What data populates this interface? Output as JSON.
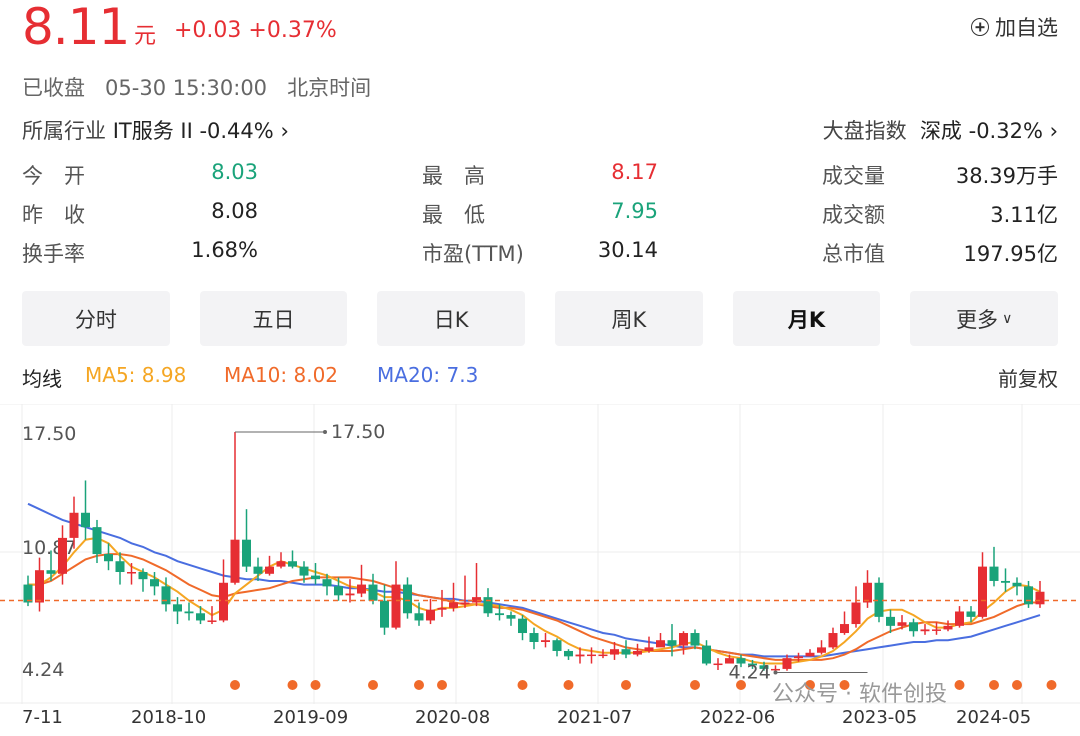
{
  "header": {
    "price": "8.11",
    "unit": "元",
    "change": "+0.03 +0.37%",
    "add_watchlist": "加自选",
    "status": "已收盘",
    "datetime": "05-30 15:30:00",
    "timezone": "北京时间",
    "industry": "所属行业",
    "industry_value": "IT服务 II -0.44%",
    "index_label": "大盘指数",
    "index_value": "深成 -0.32%"
  },
  "stats": [
    {
      "label": "今　开",
      "value": "8.03",
      "color": "green"
    },
    {
      "label": "最　高",
      "value": "8.17",
      "color": "red"
    },
    {
      "label": "成交量",
      "value": "38.39万手",
      "color": "black"
    },
    {
      "label": "昨　收",
      "value": "8.08",
      "color": "black"
    },
    {
      "label": "最　低",
      "value": "7.95",
      "color": "green"
    },
    {
      "label": "成交额",
      "value": "3.11亿",
      "color": "black"
    },
    {
      "label": "换手率",
      "value": "1.68%",
      "color": "black"
    },
    {
      "label": "市盈(TTM)",
      "value": "30.14",
      "color": "black"
    },
    {
      "label": "总市值",
      "value": "197.95亿",
      "color": "black"
    }
  ],
  "tabs": [
    "分时",
    "五日",
    "日K",
    "周K",
    "月K",
    "更多"
  ],
  "active_tab": "月K",
  "ma": {
    "title": "均线",
    "ma5": "MA5: 8.98",
    "ma10": "MA10: 8.02",
    "ma20": "MA20: 7.3",
    "adjust": "前复权"
  },
  "colors": {
    "up": "#e62e33",
    "down": "#1aa37a",
    "ma5": "#f5a623",
    "ma10": "#f06a2a",
    "ma20": "#4a6ee0"
  },
  "watermark": "公众号 · 软件创投",
  "chart_data": {
    "type": "candlestick",
    "y_labels": [
      "17.50",
      "10.87",
      "4.24"
    ],
    "ylim": [
      4.24,
      17.5
    ],
    "max_label": "17.50",
    "min_label": "4.24",
    "x_labels": [
      "7-11",
      "2018-10",
      "2019-09",
      "2020-08",
      "2021-07",
      "2022-06",
      "2023-05",
      "2024-05"
    ],
    "last_close": 8.11,
    "candles": [
      [
        9.0,
        8.0,
        9.5,
        7.8
      ],
      [
        8.0,
        9.8,
        10.5,
        7.5
      ],
      [
        9.8,
        9.6,
        10.9,
        9.2
      ],
      [
        9.6,
        11.6,
        12.3,
        9.0
      ],
      [
        11.6,
        13.0,
        13.9,
        11.0
      ],
      [
        13.0,
        12.2,
        14.8,
        11.5
      ],
      [
        12.2,
        10.7,
        12.6,
        10.2
      ],
      [
        10.7,
        10.3,
        11.3,
        9.8
      ],
      [
        10.3,
        9.7,
        10.8,
        9.0
      ],
      [
        9.7,
        9.7,
        10.2,
        9.0
      ],
      [
        9.7,
        9.3,
        9.9,
        8.6
      ],
      [
        9.3,
        8.9,
        9.7,
        8.4
      ],
      [
        8.9,
        7.9,
        9.4,
        7.5
      ],
      [
        7.9,
        7.5,
        8.3,
        6.8
      ],
      [
        7.5,
        7.4,
        8.0,
        7.0
      ],
      [
        7.4,
        7.0,
        7.8,
        6.8
      ],
      [
        7.0,
        7.0,
        7.8,
        6.8
      ],
      [
        7.0,
        9.1,
        10.4,
        6.9
      ],
      [
        9.1,
        11.5,
        17.5,
        9.0
      ],
      [
        11.5,
        10.0,
        13.2,
        9.7
      ],
      [
        10.0,
        9.6,
        10.5,
        9.2
      ],
      [
        9.6,
        10.0,
        10.6,
        9.5
      ],
      [
        10.0,
        10.3,
        10.8,
        9.9
      ],
      [
        10.3,
        10.0,
        10.9,
        9.9
      ],
      [
        10.0,
        9.5,
        10.3,
        9.1
      ],
      [
        9.5,
        9.3,
        10.2,
        9.0
      ],
      [
        9.3,
        8.9,
        9.6,
        8.4
      ],
      [
        8.9,
        8.4,
        9.4,
        8.1
      ],
      [
        8.4,
        8.5,
        9.3,
        8.0
      ],
      [
        8.5,
        9.0,
        10.1,
        8.3
      ],
      [
        9.0,
        8.1,
        9.6,
        7.9
      ],
      [
        8.1,
        6.6,
        9.0,
        6.2
      ],
      [
        6.6,
        9.0,
        10.3,
        6.5
      ],
      [
        9.0,
        7.4,
        9.4,
        7.1
      ],
      [
        7.4,
        7.0,
        8.0,
        6.7
      ],
      [
        7.0,
        7.6,
        8.2,
        6.8
      ],
      [
        7.6,
        7.7,
        8.7,
        7.2
      ],
      [
        7.7,
        8.0,
        9.1,
        7.5
      ],
      [
        8.0,
        8.0,
        9.5,
        7.7
      ],
      [
        8.0,
        8.3,
        10.2,
        7.8
      ],
      [
        8.3,
        7.4,
        8.8,
        7.2
      ],
      [
        7.4,
        7.3,
        7.9,
        7.0
      ],
      [
        7.3,
        7.1,
        7.5,
        6.7
      ],
      [
        7.1,
        6.3,
        7.3,
        5.9
      ],
      [
        6.3,
        5.8,
        6.6,
        5.4
      ],
      [
        5.8,
        5.9,
        6.3,
        5.5
      ],
      [
        5.9,
        5.3,
        6.0,
        5.0
      ],
      [
        5.3,
        5.0,
        5.4,
        4.8
      ],
      [
        5.0,
        5.1,
        5.5,
        4.6
      ],
      [
        5.1,
        5.1,
        5.5,
        4.6
      ],
      [
        5.1,
        5.1,
        5.4,
        4.9
      ],
      [
        5.1,
        5.4,
        5.8,
        4.8
      ],
      [
        5.4,
        5.1,
        5.9,
        4.9
      ],
      [
        5.1,
        5.3,
        5.7,
        5.0
      ],
      [
        5.3,
        5.5,
        6.1,
        5.2
      ],
      [
        5.5,
        5.9,
        6.3,
        5.6
      ],
      [
        5.9,
        5.6,
        6.8,
        5.0
      ],
      [
        5.6,
        6.3,
        6.4,
        5.1
      ],
      [
        6.3,
        5.6,
        6.5,
        5.4
      ],
      [
        5.6,
        4.6,
        5.9,
        4.5
      ],
      [
        4.6,
        4.6,
        4.9,
        4.24
      ],
      [
        4.6,
        4.9,
        5.1,
        4.8
      ],
      [
        4.9,
        4.6,
        5.1,
        4.4
      ],
      [
        4.6,
        4.5,
        4.8,
        4.3
      ],
      [
        4.5,
        4.3,
        4.7,
        4.2
      ],
      [
        4.3,
        4.3,
        4.5,
        4.1
      ],
      [
        4.3,
        4.9,
        5.1,
        4.2
      ],
      [
        4.9,
        5.0,
        5.2,
        4.7
      ],
      [
        5.0,
        5.2,
        5.4,
        5.0
      ],
      [
        5.2,
        5.5,
        5.9,
        5.1
      ],
      [
        5.5,
        6.3,
        6.6,
        5.4
      ],
      [
        6.3,
        6.8,
        7.5,
        6.2
      ],
      [
        6.8,
        8.0,
        8.9,
        6.6
      ],
      [
        8.0,
        9.1,
        9.8,
        7.7
      ],
      [
        9.1,
        7.2,
        9.4,
        6.9
      ],
      [
        7.2,
        6.7,
        7.6,
        6.3
      ],
      [
        6.7,
        6.9,
        7.3,
        6.5
      ],
      [
        6.9,
        6.4,
        7.1,
        6.1
      ],
      [
        6.4,
        6.5,
        6.8,
        6.2
      ],
      [
        6.5,
        6.5,
        6.9,
        6.2
      ],
      [
        6.5,
        6.7,
        7.0,
        6.4
      ],
      [
        6.7,
        7.5,
        7.8,
        6.6
      ],
      [
        7.5,
        7.2,
        7.8,
        6.9
      ],
      [
        7.2,
        10.0,
        10.8,
        7.1
      ],
      [
        10.0,
        9.2,
        11.1,
        8.9
      ],
      [
        9.2,
        9.1,
        9.9,
        8.6
      ],
      [
        9.1,
        8.9,
        9.4,
        8.4
      ],
      [
        8.9,
        7.9,
        9.2,
        7.7
      ],
      [
        7.9,
        8.6,
        9.2,
        7.7
      ]
    ],
    "ma5": [
      9.0,
      9.0,
      9.4,
      10.0,
      10.8,
      11.5,
      11.6,
      11.3,
      10.6,
      10.0,
      9.7,
      9.4,
      9.0,
      8.6,
      8.1,
      7.7,
      7.3,
      7.6,
      8.5,
      9.0,
      9.5,
      10.0,
      10.3,
      10.1,
      9.9,
      9.7,
      9.5,
      9.2,
      8.9,
      8.8,
      8.6,
      8.3,
      8.3,
      8.1,
      7.7,
      7.5,
      7.7,
      7.7,
      7.8,
      7.9,
      7.9,
      7.8,
      7.6,
      7.3,
      6.8,
      6.4,
      6.1,
      5.7,
      5.4,
      5.3,
      5.2,
      5.2,
      5.2,
      5.2,
      5.3,
      5.4,
      5.5,
      5.7,
      5.8,
      5.5,
      5.2,
      5.0,
      4.9,
      4.7,
      4.6,
      4.6,
      4.6,
      4.7,
      4.8,
      5.0,
      5.3,
      5.8,
      6.4,
      7.1,
      7.5,
      7.6,
      7.6,
      7.3,
      6.9,
      6.6,
      6.6,
      6.8,
      6.9,
      7.5,
      8.0,
      8.6,
      9.0,
      8.9,
      8.6
    ],
    "ma10": [
      9.0,
      9.0,
      9.2,
      9.6,
      10.0,
      10.4,
      10.6,
      10.7,
      10.7,
      10.6,
      10.4,
      10.1,
      9.8,
      9.4,
      9.0,
      8.7,
      8.4,
      8.3,
      8.5,
      8.6,
      8.7,
      8.8,
      9.0,
      9.2,
      9.3,
      9.4,
      9.4,
      9.4,
      9.4,
      9.3,
      9.2,
      9.0,
      8.8,
      8.6,
      8.4,
      8.3,
      8.2,
      8.0,
      7.9,
      7.9,
      7.8,
      7.7,
      7.7,
      7.6,
      7.4,
      7.2,
      7.0,
      6.7,
      6.4,
      6.1,
      5.9,
      5.7,
      5.5,
      5.4,
      5.3,
      5.3,
      5.3,
      5.4,
      5.5,
      5.4,
      5.3,
      5.2,
      5.1,
      5.0,
      4.9,
      4.8,
      4.8,
      4.8,
      4.8,
      4.8,
      4.9,
      5.1,
      5.4,
      5.8,
      6.1,
      6.4,
      6.6,
      6.8,
      6.9,
      6.9,
      6.8,
      6.8,
      6.8,
      7.0,
      7.2,
      7.5,
      7.8,
      8.0,
      8.0
    ],
    "ma20": [
      13.5,
      13.2,
      12.9,
      12.6,
      12.4,
      12.2,
      12.0,
      11.8,
      11.6,
      11.3,
      11.1,
      10.8,
      10.6,
      10.3,
      10.1,
      9.9,
      9.7,
      9.5,
      9.4,
      9.3,
      9.3,
      9.2,
      9.2,
      9.1,
      9.0,
      9.0,
      9.0,
      8.9,
      8.8,
      8.8,
      8.7,
      8.6,
      8.6,
      8.5,
      8.4,
      8.3,
      8.2,
      8.2,
      8.1,
      8.1,
      8.0,
      7.9,
      7.8,
      7.7,
      7.5,
      7.3,
      7.1,
      6.9,
      6.7,
      6.5,
      6.3,
      6.2,
      6.0,
      5.9,
      5.8,
      5.7,
      5.6,
      5.5,
      5.5,
      5.4,
      5.3,
      5.2,
      5.1,
      5.1,
      5.0,
      5.0,
      5.0,
      5.0,
      5.0,
      5.0,
      5.1,
      5.2,
      5.3,
      5.4,
      5.5,
      5.6,
      5.7,
      5.8,
      5.8,
      5.9,
      5.9,
      6.0,
      6.1,
      6.3,
      6.5,
      6.7,
      6.9,
      7.1,
      7.3
    ],
    "event_markers": [
      18,
      23,
      25,
      30,
      34,
      36,
      43,
      47,
      52,
      58,
      62,
      68,
      71,
      81,
      84,
      86,
      89
    ]
  }
}
